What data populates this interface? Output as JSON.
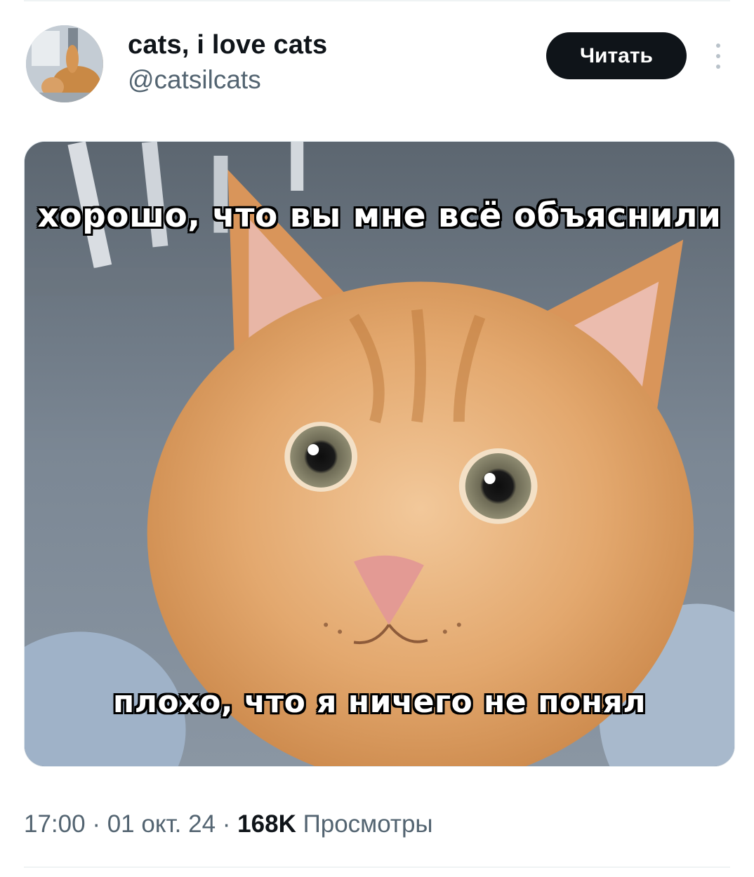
{
  "tweet": {
    "author": {
      "display_name": "cats, i love cats",
      "handle": "@catsilcats"
    },
    "follow_label": "Читать",
    "media": {
      "caption_top": "хорошо, что вы мне всё объяснили",
      "caption_bottom": "плохо, что я ничего не понял"
    },
    "meta": {
      "time": "17:00",
      "separator": " · ",
      "date": "01 окт. 24",
      "views_count": "168K",
      "views_label": " Просмотры"
    }
  },
  "colors": {
    "text_primary": "#0f1419",
    "text_secondary": "#536471",
    "button_bg": "#0f1419",
    "divider": "#eff3f4"
  },
  "icons": {
    "more": "more-vertical-icon"
  }
}
